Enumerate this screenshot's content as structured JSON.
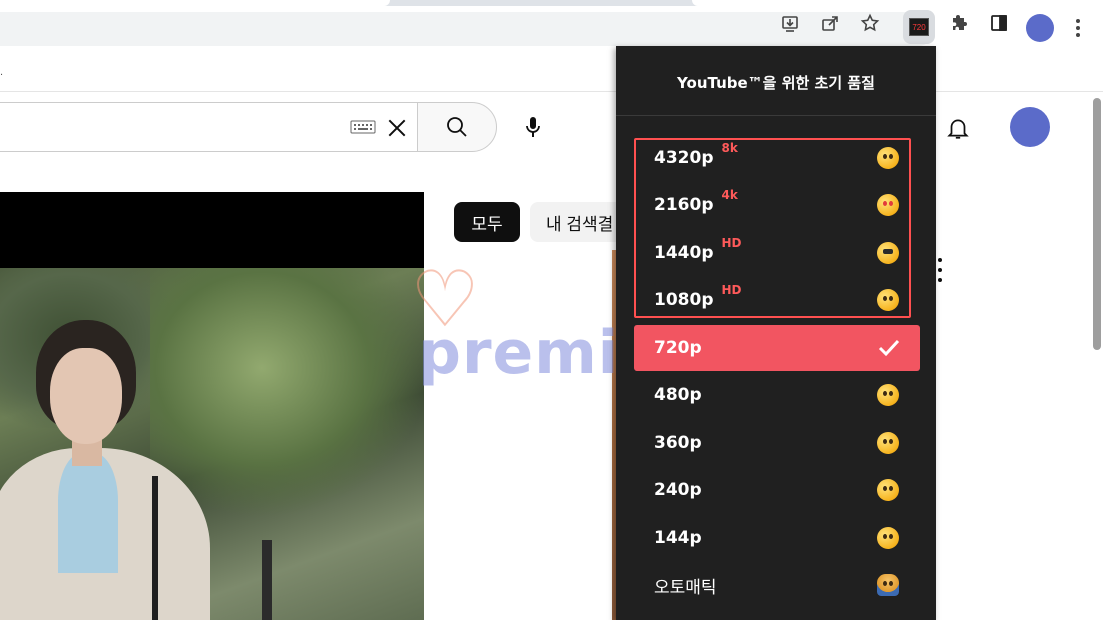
{
  "browser": {
    "extension_badge": "720",
    "icons": [
      "install-icon",
      "share-icon",
      "bookmark-star-icon",
      "extensions-puzzle-icon",
      "side-panel-icon",
      "profile-avatar",
      "kebab-menu-icon"
    ]
  },
  "bookmarks_bar": {
    "text": "."
  },
  "youtube": {
    "search_value": "",
    "chips": [
      {
        "label": "모두",
        "selected": true
      },
      {
        "label": "내 검색결"
      }
    ]
  },
  "watermark": {
    "text": "premium"
  },
  "popup": {
    "title": "YouTube™을 위한 초기 품질",
    "options": [
      {
        "label": "4320p",
        "tag": "8k",
        "emoji": "partying-face-icon",
        "premium": true
      },
      {
        "label": "2160p",
        "tag": "4k",
        "emoji": "star-struck-face-icon",
        "premium": true
      },
      {
        "label": "1440p",
        "tag": "HD",
        "emoji": "sunglasses-face-icon",
        "premium": true
      },
      {
        "label": "1080p",
        "tag": "HD",
        "emoji": "smiling-face-icon",
        "premium": true
      },
      {
        "label": "720p",
        "tag": "",
        "selected": true
      },
      {
        "label": "480p",
        "tag": "",
        "emoji": "raised-eyebrow-face-icon"
      },
      {
        "label": "360p",
        "tag": "",
        "emoji": "hand-over-mouth-face-icon"
      },
      {
        "label": "240p",
        "tag": "",
        "emoji": "persevering-face-icon"
      },
      {
        "label": "144p",
        "tag": "",
        "emoji": "crying-face-icon"
      },
      {
        "label": "오토매틱",
        "tag": "",
        "emoji": "worker-icon"
      }
    ]
  },
  "colors": {
    "popup_bg": "#202020",
    "selected_bg": "#f25561",
    "tag_color": "#ff5a5a",
    "premium_border": "#ff5050",
    "chip_dark": "#0f0f0f",
    "avatar": "#5b6bc9"
  }
}
